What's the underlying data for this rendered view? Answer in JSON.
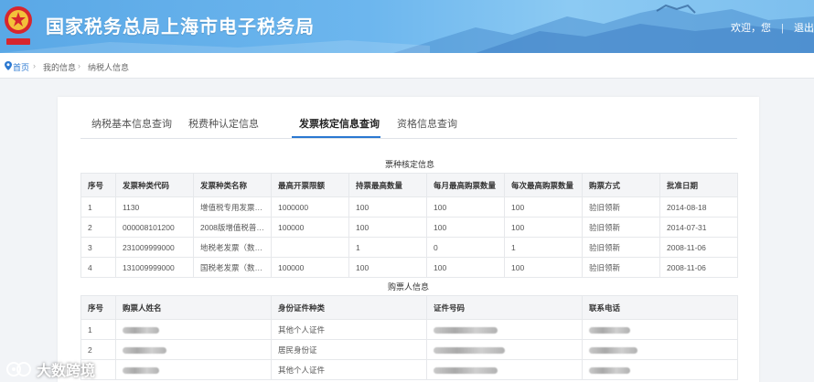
{
  "header": {
    "title": "国家税务总局上海市电子税务局",
    "greeting": "欢迎，您",
    "separator": "|",
    "logout": "退出",
    "emblem_text": "中国税务"
  },
  "breadcrumb": {
    "home": "首页",
    "level2": "我的信息",
    "level3": "纳税人信息"
  },
  "tabs": [
    {
      "label": "纳税基本信息查询",
      "active": false
    },
    {
      "label": "税费种认定信息",
      "active": false
    },
    {
      "label": "发票核定信息查询",
      "active": true
    },
    {
      "label": "资格信息查询",
      "active": false
    }
  ],
  "invoice_section": {
    "title": "票种核定信息",
    "columns": [
      "序号",
      "发票种类代码",
      "发票种类名称",
      "最高开票限额",
      "持票最高数量",
      "每月最高购票数量",
      "每次最高购票数量",
      "购票方式",
      "批准日期"
    ],
    "rows": [
      [
        "1",
        "1130",
        "增值税专用发票…",
        "1000000",
        "100",
        "100",
        "100",
        "验旧领新",
        "2014-08-18"
      ],
      [
        "2",
        "000008101200",
        "2008版增值税普…",
        "100000",
        "100",
        "100",
        "100",
        "验旧领新",
        "2014-07-31"
      ],
      [
        "3",
        "231009999000",
        "地税老发票（数…",
        "",
        "1",
        "0",
        "1",
        "验旧领新",
        "2008-11-06"
      ],
      [
        "4",
        "131009999000",
        "国税老发票（数…",
        "100000",
        "100",
        "100",
        "100",
        "验旧领新",
        "2008-11-06"
      ]
    ]
  },
  "buyer_section": {
    "title": "购票人信息",
    "columns": [
      "序号",
      "购票人姓名",
      "身份证件种类",
      "证件号码",
      "联系电话"
    ],
    "rows": [
      [
        "1",
        "",
        "其他个人证件",
        "",
        ""
      ],
      [
        "2",
        "",
        "居民身份证",
        "",
        ""
      ],
      [
        "3",
        "",
        "其他个人证件",
        "",
        ""
      ]
    ]
  },
  "watermark": {
    "text": "大数跨境"
  },
  "colors": {
    "accent": "#2a78d1",
    "header_start": "#5aa8e6",
    "header_end": "#8ccaf3"
  }
}
